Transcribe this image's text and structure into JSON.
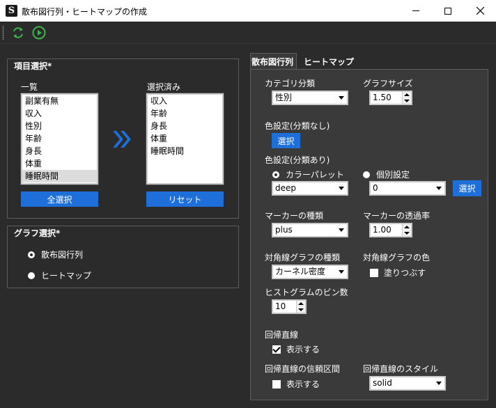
{
  "window": {
    "app_icon_letter": "S",
    "title": "散布図行列・ヒートマップの作成"
  },
  "toolbar": {
    "refresh_icon": "refresh-icon",
    "run_icon": "play-icon"
  },
  "items_group": {
    "title": "項目選択*",
    "list_label": "一覧",
    "list": [
      "副業有無",
      "収入",
      "性別",
      "年齢",
      "身長",
      "体重",
      "睡眠時間"
    ],
    "selected_label": "選択済み",
    "selected": [
      "収入",
      "年齢",
      "身長",
      "体重",
      "睡眠時間"
    ],
    "select_all_label": "全選択",
    "reset_label": "リセット"
  },
  "graph_group": {
    "title": "グラフ選択*",
    "options": [
      "散布図行列",
      "ヒートマップ"
    ]
  },
  "tabs": [
    "散布図行列",
    "ヒートマップ"
  ],
  "panel": {
    "category_label": "カテゴリ分類",
    "category_value": "性別",
    "graph_size_label": "グラフサイズ",
    "graph_size_value": "1.50",
    "color_nocat_label": "色設定(分類なし)",
    "select_label": "選択",
    "color_cat_label": "色設定(分類あり)",
    "palette_label": "カラーパレット",
    "individual_label": "個別設定",
    "palette_value": "deep",
    "individual_value": "0",
    "marker_type_label": "マーカーの種類",
    "marker_type_value": "plus",
    "marker_alpha_label": "マーカーの透過率",
    "marker_alpha_value": "1.00",
    "diag_type_label": "対角線グラフの種類",
    "diag_type_value": "カーネル密度",
    "diag_color_label": "対角線グラフの色",
    "fill_label": "塗りつぶす",
    "bins_label": "ヒストグラムのビン数",
    "bins_value": "10",
    "regression_label": "回帰直線",
    "show_label": "表示する",
    "ci_label": "回帰直線の信頼区間",
    "style_label": "回帰直線のスタイル",
    "style_value": "solid"
  },
  "colors": {
    "accent": "#1e6fd9",
    "icon_green": "#3cb54a",
    "background": "#2b2b2b",
    "panel": "#3a3a3a"
  }
}
